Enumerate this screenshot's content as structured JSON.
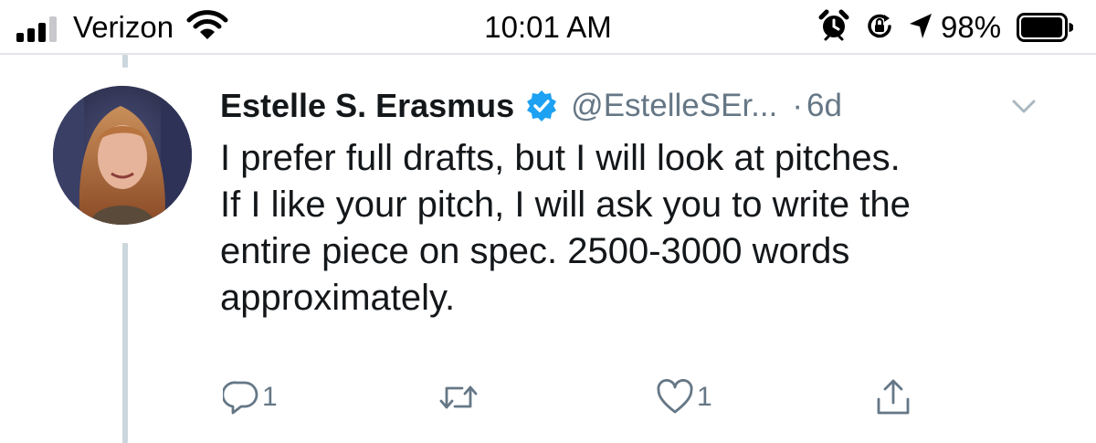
{
  "status_bar": {
    "carrier": "Verizon",
    "time": "10:01 AM",
    "battery_percent": "98%",
    "signal_bars_filled": 3,
    "signal_bars_total": 4,
    "battery_level": 0.98,
    "icons": [
      "signal-icon",
      "wifi-icon",
      "alarm-icon",
      "orientation-lock-icon",
      "location-icon",
      "battery-icon"
    ]
  },
  "tweet": {
    "display_name": "Estelle S. Erasmus",
    "handle": "@EstelleSEr...",
    "separator": "·",
    "age": "6d",
    "verified": true,
    "text_lines": [
      "I prefer full drafts, but I will look at pitches.",
      "If I like your pitch, I will ask you to write the",
      "entire piece on spec. 2500-3000 words",
      "approximately."
    ],
    "actions": {
      "reply_count": "1",
      "retweet_count": "",
      "like_count": "1"
    }
  },
  "colors": {
    "verified_blue": "#1da1f2",
    "secondary_text": "#657786",
    "primary_text": "#14171a",
    "thread_line": "#ccd6dd"
  }
}
